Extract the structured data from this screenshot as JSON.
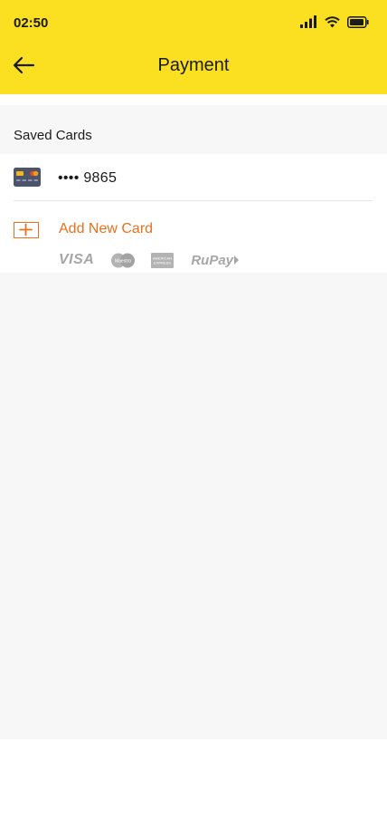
{
  "status_bar": {
    "time": "02:50"
  },
  "header": {
    "title": "Payment",
    "back_icon": "arrow-left-icon"
  },
  "saved_cards": {
    "section_title": "Saved Cards",
    "cards": [
      {
        "masked_number": "•••• 9865",
        "icon": "credit-card-icon"
      }
    ]
  },
  "add_card": {
    "label": "Add New Card",
    "icon": "plus-box-icon"
  },
  "brands": {
    "visa": "VISA",
    "maestro": "Maestro",
    "amex": "AMERICAN EXPRESS",
    "rupay": "RuPay"
  },
  "colors": {
    "header_bg": "#fae021",
    "accent": "#e8711a",
    "page_bg": "#f7f7f7"
  }
}
